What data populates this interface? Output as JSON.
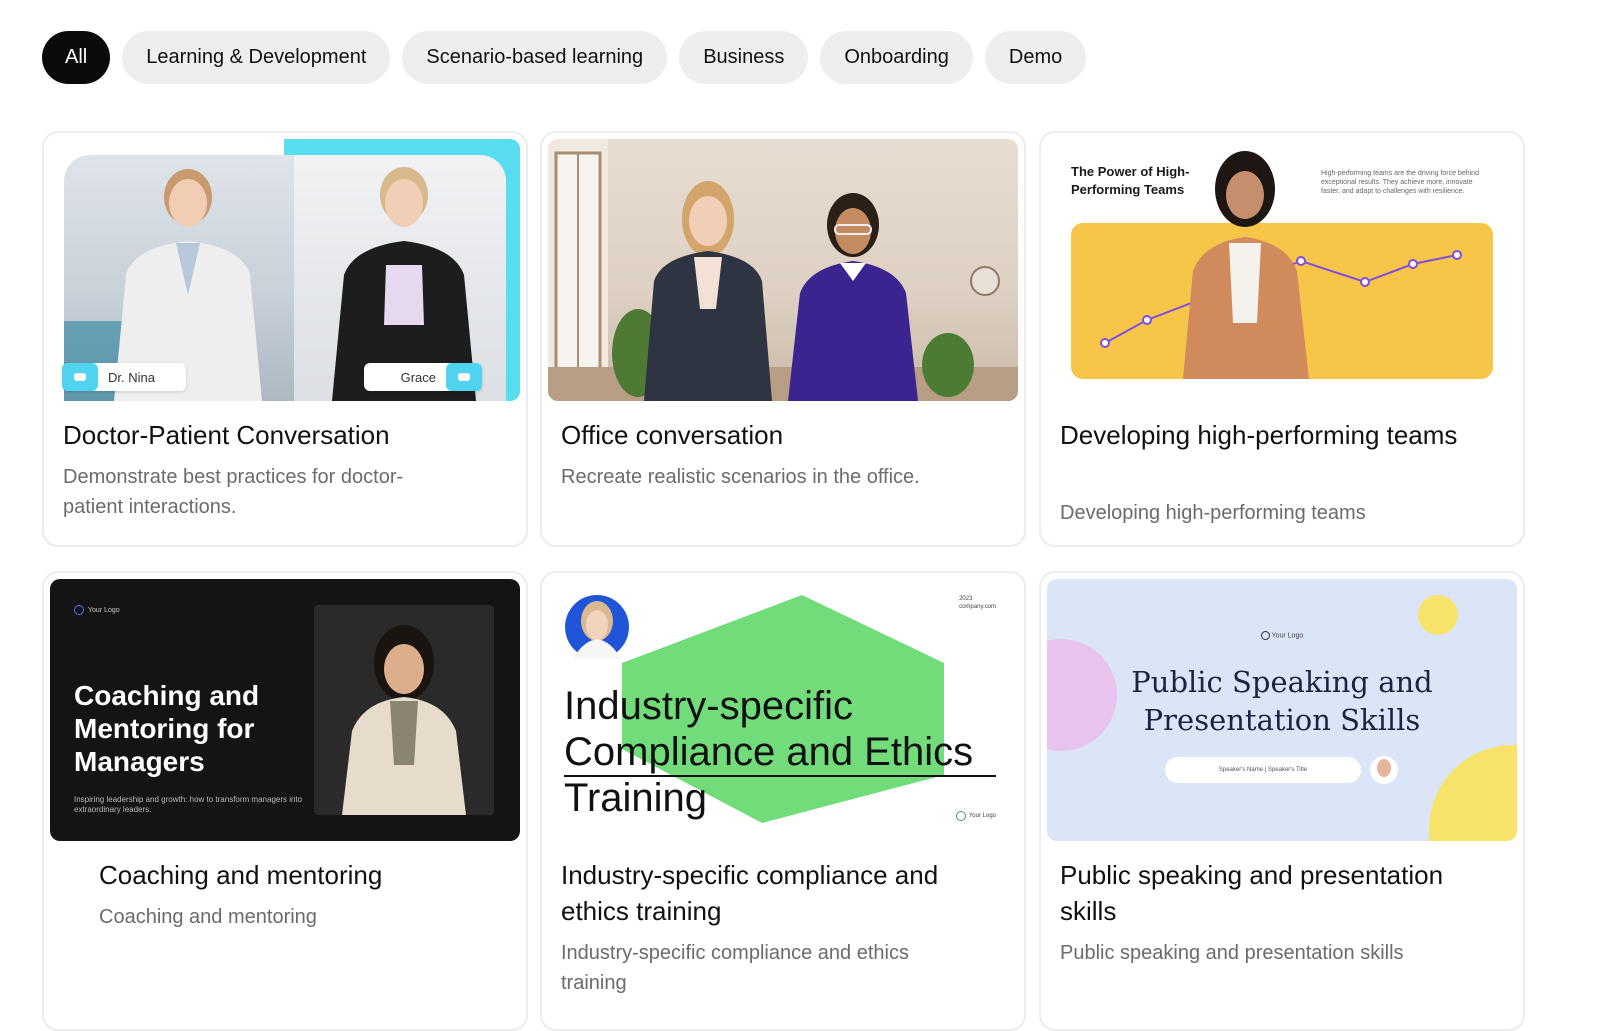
{
  "filters": [
    "All",
    "Learning & Development",
    "Scenario-based learning",
    "Business",
    "Onboarding",
    "Demo"
  ],
  "active_filter": "All",
  "cards": [
    {
      "title": "Doctor-Patient Conversation",
      "description": "Demonstrate best practices for doctor-patient interactions.",
      "thumb": {
        "tag_left": "Dr. Nina",
        "tag_right": "Grace"
      }
    },
    {
      "title": "Office conversation",
      "description": "Recreate realistic scenarios in the office."
    },
    {
      "title": "Developing high-performing teams",
      "description": "Developing high-performing teams",
      "thumb": {
        "heading": "The Power of High-Performing Teams",
        "blurb": "High-performing teams are the driving force behind exceptional results. They achieve more, innovate faster, and adapt to challenges with resilience."
      }
    },
    {
      "title": "Coaching and mentoring",
      "description": "Coaching and mentoring",
      "thumb": {
        "logo": "Your Logo",
        "heading": "Coaching and Mentoring for Managers",
        "sub": "Inspiring leadership and growth: how to transform managers into extraordinary leaders."
      }
    },
    {
      "title": "Industry-specific compliance and ethics training",
      "description": "Industry-specific compliance and ethics training",
      "thumb": {
        "heading_1": "Industry-specific",
        "heading_2": "Compliance and Ethics",
        "heading_3": "Training",
        "year": "2023",
        "site": "company.com",
        "logo": "Your Logo"
      }
    },
    {
      "title": "Public speaking and presentation skills",
      "description": "Public speaking and presentation skills",
      "thumb": {
        "logo": "Your Logo",
        "heading_1": "Public Speaking and",
        "heading_2": "Presentation Skills",
        "speaker": "Speaker's Name  |  Speaker's Title"
      }
    }
  ],
  "colors": {
    "active_chip": "#0b0b0b",
    "chip": "#eeeeee",
    "accent_cyan": "#58dcf0",
    "accent_green": "#72dc7b",
    "accent_yellow": "#f7c548"
  }
}
